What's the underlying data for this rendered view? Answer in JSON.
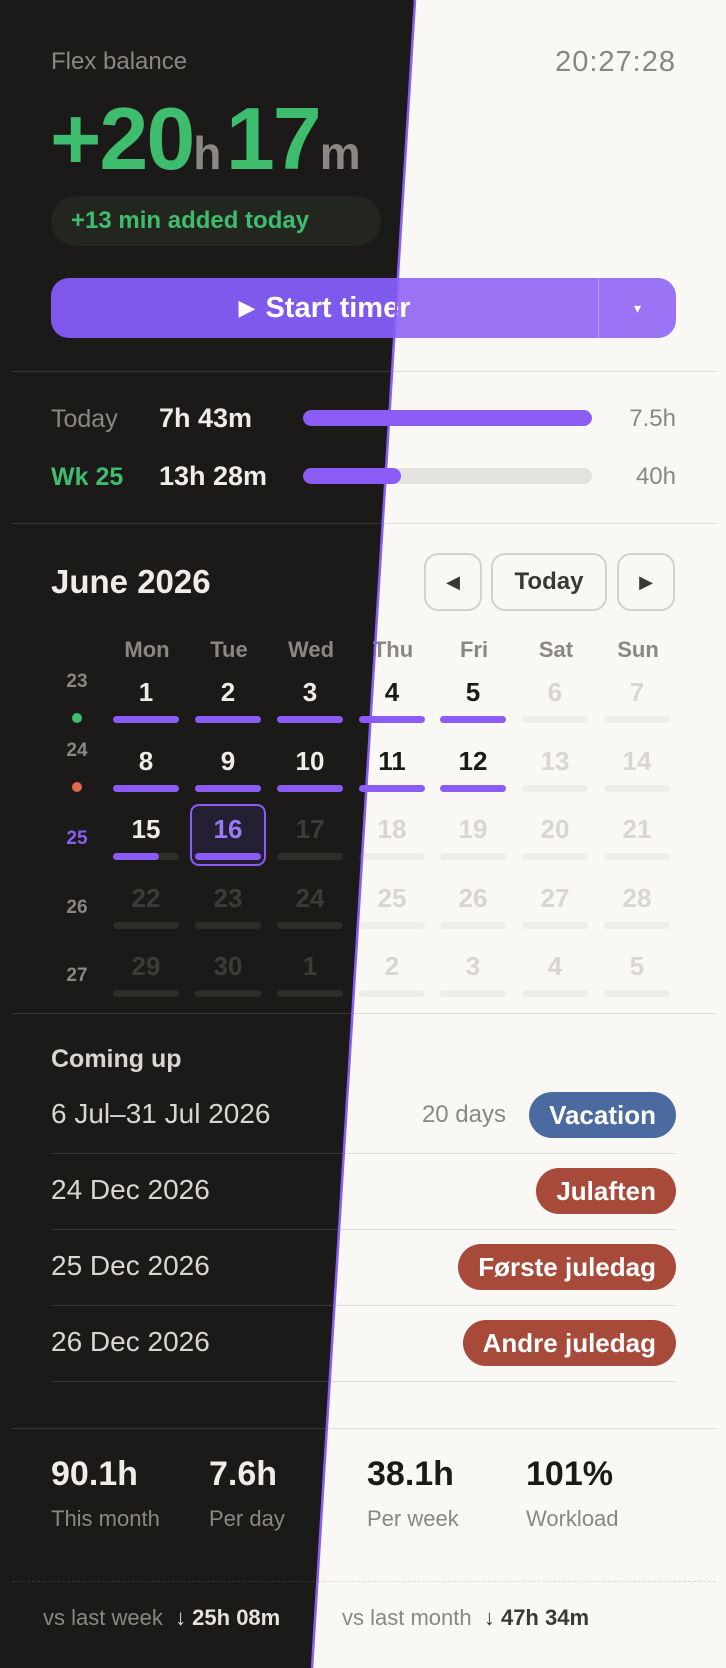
{
  "header": {
    "flex_label": "Flex balance",
    "clock": "20:27:28",
    "balance_sign_hours": "+20",
    "hours_unit": "h",
    "minutes": "17",
    "minutes_unit": "m",
    "added_today": "+13 min added today"
  },
  "timer": {
    "label": "Start timer",
    "play_icon": "▶",
    "dropdown_icon": "▾"
  },
  "progress": {
    "today": {
      "label": "Today",
      "value": "7h 43m",
      "target": "7.5h",
      "fraction": 1.0
    },
    "week": {
      "label": "Wk 25",
      "value": "13h 28m",
      "target": "40h",
      "fraction": 0.34
    }
  },
  "calendar": {
    "month_title": "June 2026",
    "prev_icon": "◀",
    "today_label": "Today",
    "next_icon": "▶",
    "weekdays": [
      "Mon",
      "Tue",
      "Wed",
      "Thu",
      "Fri",
      "Sat",
      "Sun"
    ],
    "weeks": [
      {
        "num": "23",
        "dot": "#3fbd6e",
        "days": [
          "1",
          "2",
          "3",
          "4",
          "5",
          "6",
          "7"
        ]
      },
      {
        "num": "24",
        "dot": "#e06a4e",
        "days": [
          "8",
          "9",
          "10",
          "11",
          "12",
          "13",
          "14"
        ]
      },
      {
        "num": "25",
        "dot": null,
        "days": [
          "15",
          "16",
          "17",
          "18",
          "19",
          "20",
          "21"
        ]
      },
      {
        "num": "26",
        "dot": null,
        "days": [
          "22",
          "23",
          "24",
          "25",
          "26",
          "27",
          "28"
        ]
      },
      {
        "num": "27",
        "dot": null,
        "days": [
          "29",
          "30",
          "1",
          "2",
          "3",
          "4",
          "5"
        ]
      }
    ],
    "current_week_color": "#8b5cf6"
  },
  "coming_up": {
    "title": "Coming up",
    "items": [
      {
        "date": "6 Jul–31 Jul 2026",
        "days": "20 days",
        "tag": "Vacation",
        "color": "#4a6aa0"
      },
      {
        "date": "24 Dec 2026",
        "days": "",
        "tag": "Julaften",
        "color": "#a84a3a"
      },
      {
        "date": "25 Dec 2026",
        "days": "",
        "tag": "Første juledag",
        "color": "#a84a3a"
      },
      {
        "date": "26 Dec 2026",
        "days": "",
        "tag": "Andre juledag",
        "color": "#a84a3a"
      }
    ]
  },
  "stats": [
    {
      "value": "90.1h",
      "label": "This month"
    },
    {
      "value": "7.6h",
      "label": "Per day"
    },
    {
      "value": "38.1h",
      "label": "Per week"
    },
    {
      "value": "101%",
      "label": "Workload"
    }
  ],
  "comparison": {
    "week_label": "vs last week",
    "week_value": "↓ 25h 08m",
    "month_label": "vs last month",
    "month_value": "↓ 47h 34m"
  },
  "colors": {
    "accent": "#8b5cf6",
    "positive": "#3fbd6e",
    "dark_bg": "#1b1a18",
    "light_bg": "#faf8f5"
  }
}
